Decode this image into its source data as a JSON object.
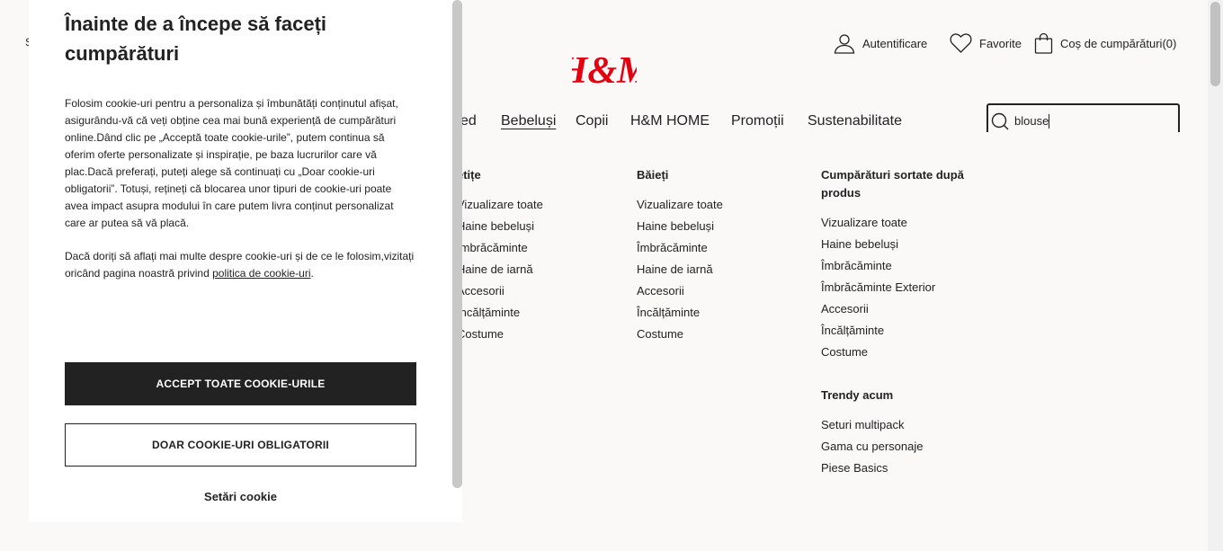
{
  "header": {
    "left_util": "S",
    "login": "Autentificare",
    "favorites": "Favorite",
    "cart": "Coș de cumpărături(0)",
    "brand": "H&M",
    "brand_color": "#e50010"
  },
  "nav": {
    "items": [
      "ed",
      "Bebeluși",
      "Copii",
      "H&M HOME",
      "Promoții",
      "Sustenabilitate"
    ],
    "active": "Bebeluși"
  },
  "search": {
    "value": "blouse"
  },
  "menu": {
    "col1": {
      "heading": "etițe",
      "links": [
        "Vizualizare toate",
        "Haine bebeluși",
        "Îmbrăcăminte",
        "Haine de iarnă",
        "Accesorii",
        "Încălțăminte",
        "Costume"
      ]
    },
    "col2": {
      "heading": "Băieți",
      "links": [
        "Vizualizare toate",
        "Haine bebeluși",
        "Îmbrăcăminte",
        "Haine de iarnă",
        "Accesorii",
        "Încălțăminte",
        "Costume"
      ]
    },
    "col3": {
      "heading": "Cumpărături sortate după produs",
      "links": [
        "Vizualizare toate",
        "Haine bebeluși",
        "Îmbrăcăminte",
        "Îmbrăcăminte Exterior",
        "Accesorii",
        "Încălțăminte",
        "Costume"
      ]
    },
    "col4": {
      "heading": "Trendy acum",
      "links": [
        "Seturi multipack",
        "Gama cu personaje",
        "Piese Basics"
      ]
    }
  },
  "cookie": {
    "title": "Înainte de a începe să faceți cumpărături",
    "para1": "Folosim cookie-uri pentru a personaliza și îmbunătăți conținutul afișat, asigurându-vă că veți obține cea mai bună experiență de cumpărături online.Dând clic pe „Acceptă toate cookie-urile”, putem continua să oferim oferte personalizate și inspirație, pe baza lucrurilor care vă plac.Dacă preferați, puteți alege să continuați cu „Doar cookie-uri obligatorii”. Totuși, rețineți că blocarea unor tipuri de cookie-uri poate avea impact asupra modului în care putem livra conținut personalizat care ar putea să vă placă.",
    "para2_prefix": "Dacă doriți să aflați mai multe despre cookie-uri și de ce le folosim,vizitați oricând pagina noastră privind ",
    "para2_link": "politica de cookie-uri",
    "para2_suffix": ".",
    "accept_label": "ACCEPT TOATE COOKIE-URILE",
    "required_label": "DOAR COOKIE-URI OBLIGATORII",
    "settings_label": "Setări cookie"
  }
}
